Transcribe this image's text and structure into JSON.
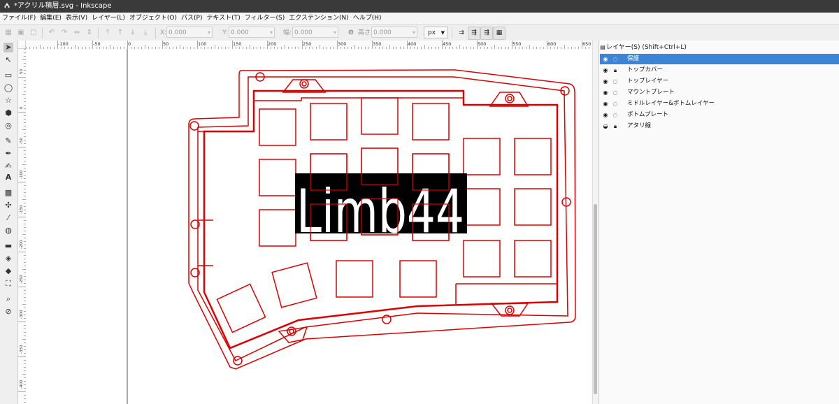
{
  "window": {
    "title": "*アクリル積層.svg - Inkscape"
  },
  "menu": [
    "ファイル(F)",
    "編集(E)",
    "表示(V)",
    "レイヤー(L)",
    "オブジェクト(O)",
    "パス(P)",
    "テキスト(T)",
    "フィルター(S)",
    "エクステンション(N)",
    "ヘルプ(H)"
  ],
  "toolbar": {
    "x_label": "X:",
    "x_value": "0.000",
    "y_label": "Y:",
    "y_value": "0.000",
    "w_label": "幅:",
    "w_value": "0.000",
    "h_label": "高さ:",
    "h_value": "0.000",
    "unit": "px"
  },
  "ruler": {
    "h_labels": [
      "-100",
      "-50",
      "0",
      "50",
      "100",
      "150",
      "200",
      "250",
      "300",
      "350",
      "400",
      "450",
      "500",
      "550",
      "600",
      "650"
    ],
    "v_labels": [
      "50",
      "0",
      "-50",
      "-100",
      "-150",
      "-200",
      "-250",
      "-300",
      "-350",
      "-400",
      "-450",
      "-500"
    ]
  },
  "canvas": {
    "logo_text": "Limb44",
    "stroke_color": "#e00000"
  },
  "layers_panel": {
    "title": "レイヤー(S) (Shift+Ctrl+L)",
    "layers": [
      {
        "name": "保護",
        "visible": true,
        "locked": false,
        "selected": true
      },
      {
        "name": "トップカバー",
        "visible": true,
        "locked": true,
        "selected": false
      },
      {
        "name": "トップレイヤー",
        "visible": true,
        "locked": false,
        "selected": false
      },
      {
        "name": "マウントプレート",
        "visible": true,
        "locked": false,
        "selected": false
      },
      {
        "name": "ミドルレイヤー&ボトムレイヤー",
        "visible": true,
        "locked": false,
        "selected": false
      },
      {
        "name": "ボトムプレート",
        "visible": true,
        "locked": false,
        "selected": false
      },
      {
        "name": "アタリ線",
        "visible": false,
        "locked": true,
        "selected": false
      }
    ]
  }
}
